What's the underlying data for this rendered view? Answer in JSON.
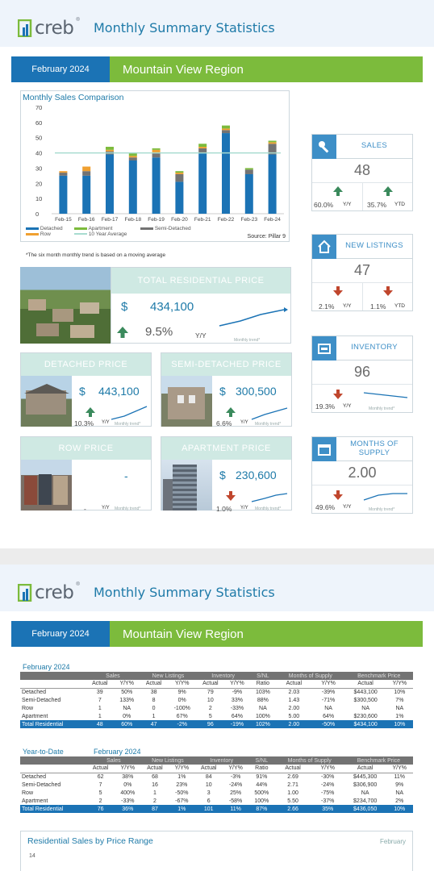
{
  "page1": {
    "logo": "creb",
    "logo_reg": "®",
    "title": "Monthly Summary Statistics",
    "date": "February 2024",
    "region": "Mountain View Region",
    "sales_chart": {
      "title": "Monthly Sales Comparison",
      "source": "Source: Pillar 9",
      "legend": [
        "Detached",
        "Apartment",
        "Semi-Detached",
        "Row",
        "10 Year Average"
      ]
    },
    "footnote": "*The six month monthly trend is based on a moving average",
    "total_price": {
      "label": "TOTAL RESIDENTIAL PRICE",
      "currency": "$",
      "value": "434,100",
      "pct": "9.5%",
      "yy": "Y/Y",
      "trend": "Monthly trend*"
    },
    "detached": {
      "label": "DETACHED PRICE",
      "currency": "$",
      "value": "443,100",
      "pct": "10.3%",
      "yy": "Y/Y",
      "trend": "Monthly trend*"
    },
    "semi": {
      "label": "SEMI-DETACHED PRICE",
      "currency": "$",
      "value": "300,500",
      "pct": "6.6%",
      "yy": "Y/Y",
      "trend": "Monthly trend*"
    },
    "row": {
      "label": "ROW PRICE",
      "value": "-",
      "pct": "-",
      "yy": "Y/Y",
      "trend": "Monthly trend*"
    },
    "apartment": {
      "label": "APARTMENT PRICE",
      "currency": "$",
      "value": "230,600",
      "pct": "1.0%",
      "yy": "Y/Y",
      "trend": "Monthly trend*"
    },
    "stats": [
      {
        "label": "SALES",
        "value": "48",
        "a": "60.0%",
        "a_l": "Y/Y",
        "b": "35.7%",
        "b_l": "YTD",
        "icon": "key-icon"
      },
      {
        "label": "NEW LISTINGS",
        "value": "47",
        "a": "2.1%",
        "a_l": "Y/Y",
        "b": "1.1%",
        "b_l": "YTD",
        "icon": "house-icon"
      },
      {
        "label": "INVENTORY",
        "value": "96",
        "a": "19.3%",
        "a_l": "Y/Y",
        "trend": "Monthly trend*",
        "icon": "inventory-icon"
      },
      {
        "label": "MONTHS OF SUPPLY",
        "value": "2.00",
        "a": "49.6%",
        "a_l": "Y/Y",
        "trend": "Monthly trend*",
        "icon": "calendar-icon"
      }
    ]
  },
  "chart_data": {
    "type": "bar",
    "title": "Monthly Sales Comparison",
    "categories": [
      "Feb-15",
      "Feb-16",
      "Feb-17",
      "Feb-18",
      "Feb-19",
      "Feb-20",
      "Feb-21",
      "Feb-22",
      "Feb-23",
      "Feb-24"
    ],
    "ylim": [
      0,
      70
    ],
    "yticks": [
      0,
      10,
      20,
      30,
      40,
      50,
      60,
      70
    ],
    "series": [
      {
        "name": "Detached",
        "color": "#1b73b5",
        "values": [
          25,
          25,
          39,
          35,
          37,
          21,
          40,
          53,
          26,
          39
        ]
      },
      {
        "name": "Semi-Detached",
        "color": "#737373",
        "values": [
          2,
          3,
          2,
          2,
          3,
          5,
          3,
          2,
          3,
          7
        ]
      },
      {
        "name": "Row",
        "color": "#f0a030",
        "values": [
          1,
          3,
          1,
          1,
          2,
          1,
          1,
          1,
          0,
          1
        ]
      },
      {
        "name": "Apartment",
        "color": "#7cbb3c",
        "values": [
          0,
          0,
          2,
          2,
          1,
          1,
          2,
          2,
          1,
          1
        ]
      }
    ],
    "average": {
      "name": "10 Year Average",
      "color": "#a8dcd0",
      "value": 40
    },
    "legend_position": "bottom",
    "grid": false
  },
  "page2": {
    "logo": "creb",
    "logo_reg": "®",
    "title": "Monthly Summary Statistics",
    "date": "February 2024",
    "region": "Mountain View Region",
    "groups": [
      "Sales",
      "New Listings",
      "Inventory",
      "S/NL",
      "Months of Supply",
      "Benchmark Price"
    ],
    "subheads": [
      "Actual",
      "Y/Y%",
      "Actual",
      "Y/Y%",
      "Actual",
      "Y/Y%",
      "Ratio",
      "Actual",
      "Y/Y%",
      "Actual",
      "Y/Y%"
    ],
    "monthly_title": "February 2024",
    "monthly": [
      [
        "Detached",
        "39",
        "50%",
        "38",
        "9%",
        "79",
        "-9%",
        "103%",
        "2.03",
        "-39%",
        "$443,100",
        "10%"
      ],
      [
        "Semi-Detached",
        "7",
        "133%",
        "8",
        "0%",
        "10",
        "33%",
        "88%",
        "1.43",
        "-71%",
        "$300,500",
        "7%"
      ],
      [
        "Row",
        "1",
        "NA",
        "0",
        "-100%",
        "2",
        "-33%",
        "NA",
        "2.00",
        "NA",
        "NA",
        "NA"
      ],
      [
        "Apartment",
        "1",
        "0%",
        "1",
        "67%",
        "5",
        "64%",
        "100%",
        "5.00",
        "64%",
        "$230,600",
        "1%"
      ],
      [
        "Total Residential",
        "48",
        "60%",
        "47",
        "-2%",
        "96",
        "-19%",
        "102%",
        "2.00",
        "-50%",
        "$434,100",
        "10%"
      ]
    ],
    "ytd_title": "Year-to-Date",
    "ytd_date": "February 2024",
    "ytd": [
      [
        "Detached",
        "62",
        "38%",
        "68",
        "1%",
        "84",
        "-3%",
        "91%",
        "2.69",
        "-30%",
        "$445,300",
        "11%"
      ],
      [
        "Semi-Detached",
        "7",
        "0%",
        "16",
        "23%",
        "10",
        "-24%",
        "44%",
        "2.71",
        "-24%",
        "$306,900",
        "9%"
      ],
      [
        "Row",
        "5",
        "400%",
        "1",
        "-50%",
        "3",
        "25%",
        "500%",
        "1.00",
        "-75%",
        "NA",
        "NA"
      ],
      [
        "Apartment",
        "2",
        "-33%",
        "2",
        "-67%",
        "6",
        "-58%",
        "100%",
        "5.50",
        "-37%",
        "$234,700",
        "2%"
      ],
      [
        "Total Residential",
        "76",
        "36%",
        "87",
        "1%",
        "101",
        "11%",
        "87%",
        "2.66",
        "35%",
        "$436,050",
        "10%"
      ]
    ],
    "price_range_title": "Residential Sales by Price Range",
    "price_range_month": "February",
    "price_range_tick": "14"
  }
}
